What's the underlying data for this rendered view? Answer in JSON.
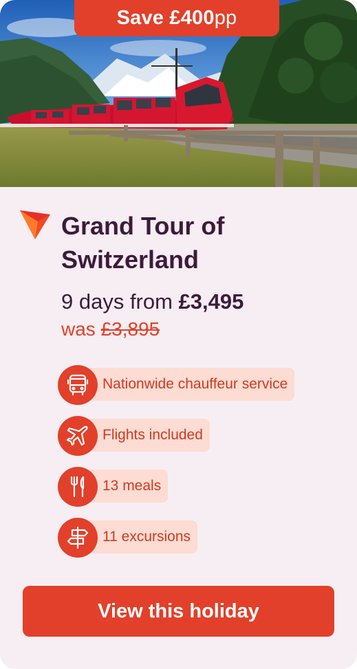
{
  "badge": {
    "strong": "Save £400",
    "light": "pp"
  },
  "title": "Grand Tour of Switzerland",
  "price": {
    "prefix": "9 days from ",
    "amount": "£3,495"
  },
  "was": {
    "prefix": "was ",
    "amount": "£3,895"
  },
  "features": [
    {
      "label": "Nationwide chauffeur service",
      "icon": "coach-icon"
    },
    {
      "label": "Flights included",
      "icon": "plane-icon"
    },
    {
      "label": "13 meals",
      "icon": "cutlery-icon"
    },
    {
      "label": "11 excursions",
      "icon": "signpost-icon"
    }
  ],
  "cta": {
    "label": "View this holiday"
  },
  "colors": {
    "accent": "#e2402a",
    "dark": "#3e1a3c",
    "card_bg": "#f6eef2",
    "pill_bg": "#fcdcd3"
  }
}
